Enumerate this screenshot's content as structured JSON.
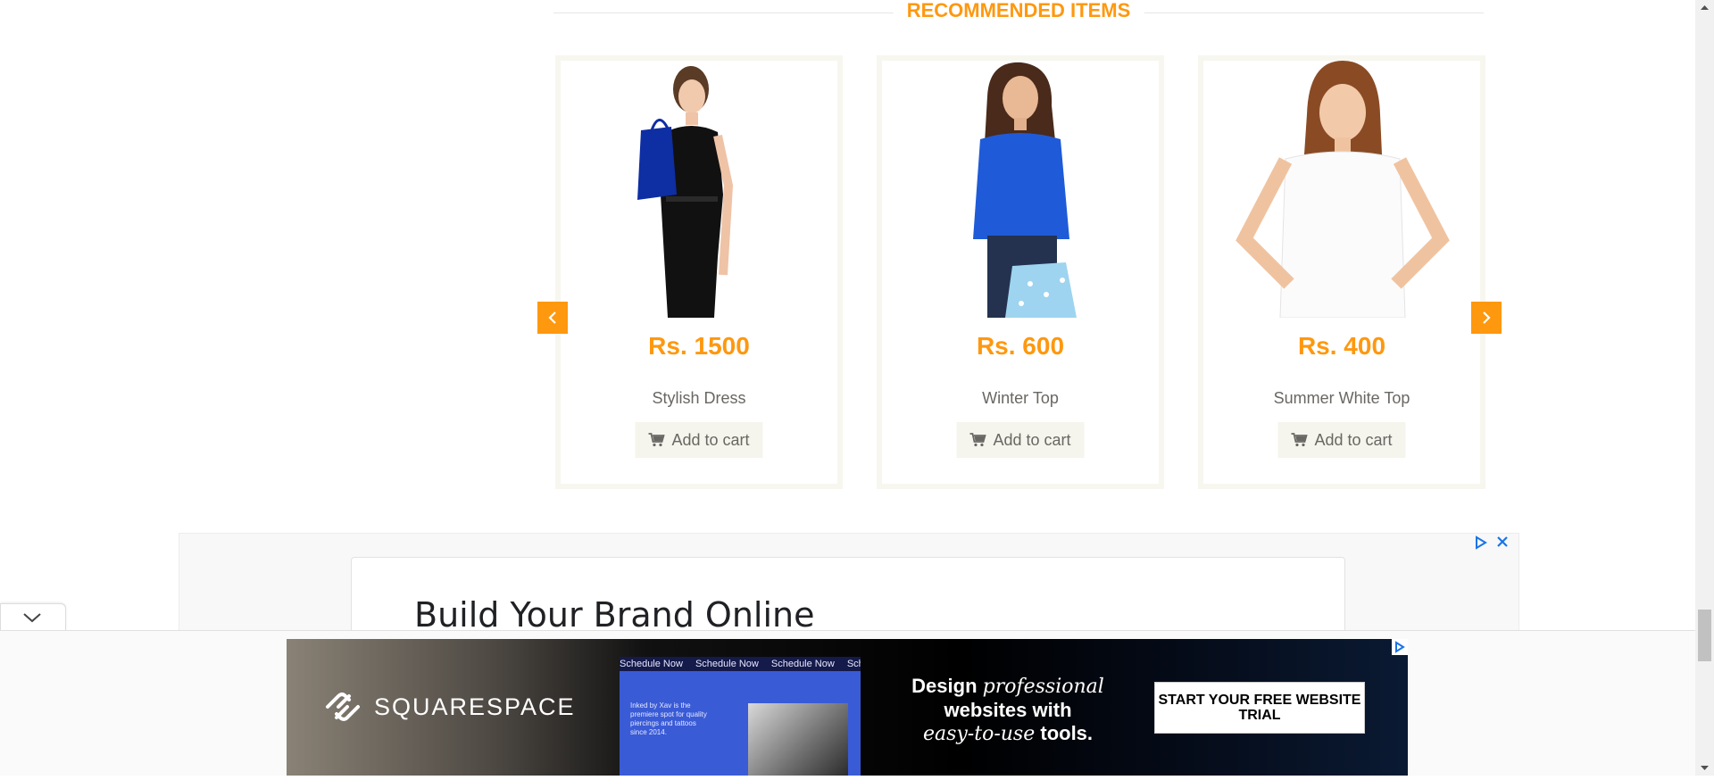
{
  "recommended": {
    "title": "RECOMMENDED ITEMS",
    "products": [
      {
        "price": "Rs. 1500",
        "name": "Stylish Dress",
        "cart_label": "Add to cart"
      },
      {
        "price": "Rs. 600",
        "name": "Winter Top",
        "cart_label": "Add to cart"
      },
      {
        "price": "Rs. 400",
        "name": "Summer White Top",
        "cart_label": "Add to cart"
      }
    ]
  },
  "ad": {
    "heading": "Build Your Brand Online"
  },
  "banner": {
    "brand": "SQUARESPACE",
    "screenshot_nav": [
      "Schedule Now",
      "Schedule Now",
      "Schedule Now",
      "Schedule Now"
    ],
    "screenshot_body": "Inked by Xav is the premiere spot for quality piercings and tattoos since 2014.",
    "tagline_line1_a": "Design ",
    "tagline_line1_b": "professional",
    "tagline_line2": "websites with",
    "tagline_line3_a": "easy-to-use",
    "tagline_line3_b": " tools.",
    "cta": "START YOUR FREE WEBSITE TRIAL"
  },
  "colors": {
    "accent": "#fe980f",
    "card_border": "#f7f7f0",
    "button_bg": "#f5f5ed",
    "text_muted": "#696763"
  },
  "icons": {
    "carousel_prev": "chevron-left-icon",
    "carousel_next": "chevron-right-icon",
    "cart": "shopping-cart-icon",
    "ad_choices": "ad-choices-icon",
    "close": "close-icon",
    "collapse": "chevron-down-icon"
  }
}
